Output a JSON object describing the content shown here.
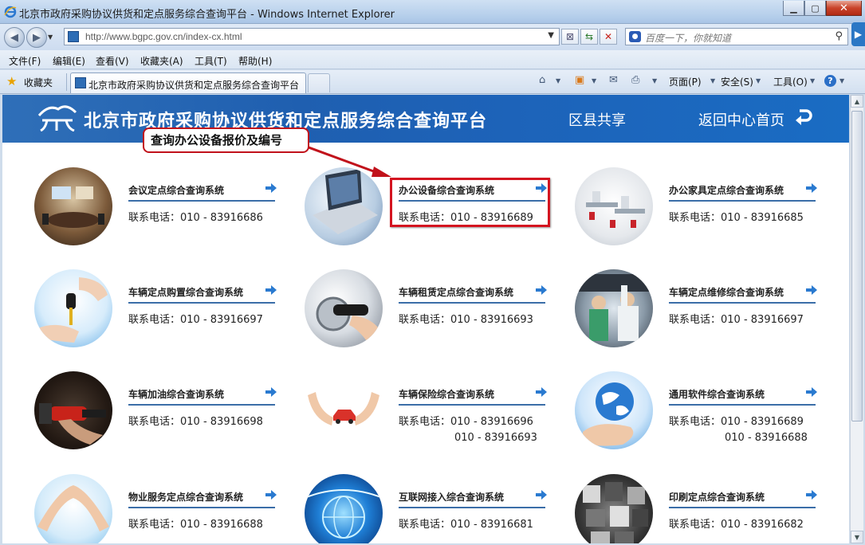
{
  "window": {
    "title": "北京市政府采购协议供货和定点服务综合查询平台 - Windows Internet Explorer",
    "minimize_icon": "minimize-icon",
    "maximize_icon": "maximize-icon",
    "close_icon": "close-icon"
  },
  "address_bar": {
    "url": "http://www.bgpc.gov.cn/index-cx.html",
    "search_placeholder": "百度一下，你就知道"
  },
  "menu": {
    "items": [
      "文件(F)",
      "编辑(E)",
      "查看(V)",
      "收藏夹(A)",
      "工具(T)",
      "帮助(H)"
    ]
  },
  "favorites_bar": {
    "favorites_label": "收藏夹",
    "tab_title": "北京市政府采购协议供货和定点服务综合查询平台",
    "commands": [
      "页面(P)",
      "安全(S)",
      "工具(O)"
    ]
  },
  "page": {
    "banner_title": "北京市政府采购协议供货和定点服务综合查询平台",
    "district_share": "区县共享",
    "back_home": "返回中心首页",
    "callout_text": "查询办公设备报价及编号",
    "accent_color": "#1f5fb0",
    "highlight_color": "#d41420",
    "phone_label": "联系电话：",
    "services": [
      {
        "name": "会议定点综合查询系统",
        "phones": [
          "010 - 83916686"
        ]
      },
      {
        "name": "办公设备综合查询系统",
        "phones": [
          "010 - 83916689"
        ]
      },
      {
        "name": "办公家具定点综合查询系统",
        "phones": [
          "010 - 83916685"
        ]
      },
      {
        "name": "车辆定点购置综合查询系统",
        "phones": [
          "010 - 83916697"
        ]
      },
      {
        "name": "车辆租赁定点综合查询系统",
        "phones": [
          "010 - 83916693"
        ]
      },
      {
        "name": "车辆定点维修综合查询系统",
        "phones": [
          "010 - 83916697"
        ]
      },
      {
        "name": "车辆加油综合查询系统",
        "phones": [
          "010 - 83916698"
        ]
      },
      {
        "name": "车辆保险综合查询系统",
        "phones": [
          "010 - 83916696",
          "010 - 83916693"
        ]
      },
      {
        "name": "通用软件综合查询系统",
        "phones": [
          "010 - 83916689",
          "010 - 83916688"
        ]
      },
      {
        "name": "物业服务定点综合查询系统",
        "phones": [
          "010 - 83916688"
        ]
      },
      {
        "name": "互联网接入综合查询系统",
        "phones": [
          "010 - 83916681"
        ]
      },
      {
        "name": "印刷定点综合查询系统",
        "phones": [
          "010 - 83916682"
        ]
      }
    ]
  }
}
